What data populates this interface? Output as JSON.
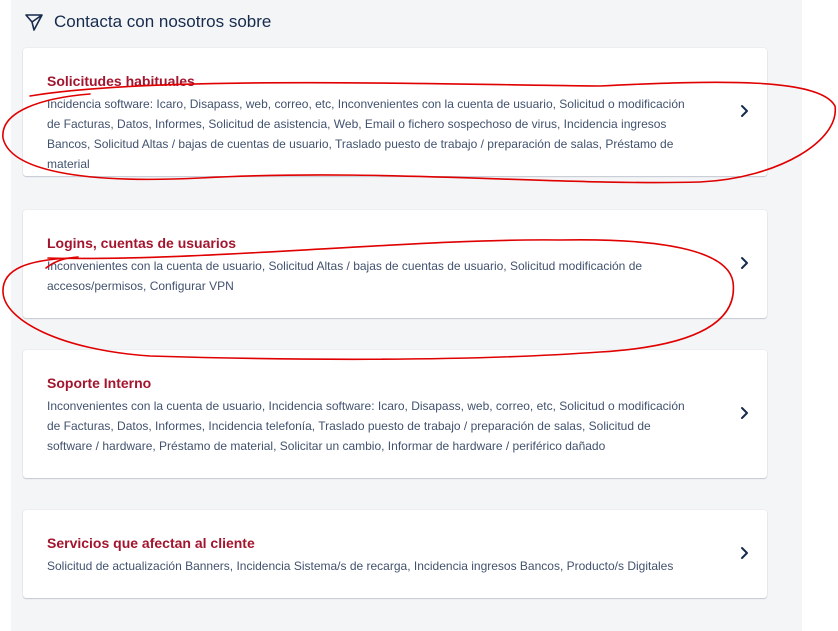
{
  "header": {
    "title": "Contacta con nosotros sobre",
    "icon": "send-icon"
  },
  "cards": [
    {
      "title": "Solicitudes habituales",
      "description": "Incidencia software: Icaro, Disapass, web, correo, etc, Inconvenientes con la cuenta de usuario, Solicitud o modificación de Facturas, Datos, Informes, Solicitud de asistencia, Web, Email o fichero sospechoso de virus, Incidencia ingresos Bancos, Solicitud Altas / bajas de cuentas de usuario, Traslado puesto de trabajo / preparación de salas, Préstamo de material"
    },
    {
      "title": "Logins, cuentas de usuarios",
      "description": "Inconvenientes con la cuenta de usuario, Solicitud Altas / bajas de cuentas de usuario, Solicitud modificación de accesos/permisos, Configurar VPN"
    },
    {
      "title": "Soporte Interno",
      "description": "Inconvenientes con la cuenta de usuario, Incidencia software: Icaro, Disapass, web, correo, etc, Solicitud o modificación de Facturas, Datos, Informes, Incidencia telefonía, Traslado puesto de trabajo / preparación de salas, Solicitud de software / hardware, Préstamo de material, Solicitar un cambio, Informar de hardware / periférico dañado"
    },
    {
      "title": "Servicios que afectan al cliente",
      "description": "Solicitud de actualización Banners, Incidencia Sistema/s de recarga, Incidencia ingresos Bancos, Producto/s Digitales"
    }
  ],
  "colors": {
    "card_title": "#a3152e",
    "annotation": "#e00000",
    "panel_bg": "#f4f5f7"
  }
}
